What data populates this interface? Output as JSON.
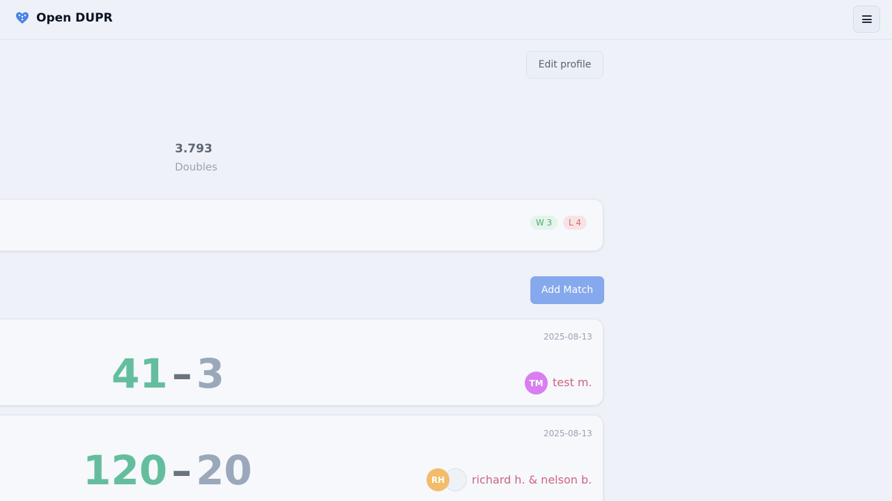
{
  "header": {
    "app_name": "Open DUPR",
    "logo_icon": "pickleball-heart-icon",
    "menu_icon": "hamburger-menu-icon"
  },
  "profile": {
    "edit_label": "Edit profile",
    "rating": {
      "value": "3.793",
      "label": "Doubles"
    }
  },
  "record": {
    "wins": "W 3",
    "losses": "L 4"
  },
  "matches_section": {
    "add_label": "Add Match"
  },
  "matches": [
    {
      "date": "2025-08-13",
      "score_for": "41",
      "dash": "–",
      "score_against": "3",
      "opponent_initials": "TM",
      "opponent_names": "test m."
    },
    {
      "date": "2025-08-13",
      "score_for": "120",
      "dash": "–",
      "score_against": "20",
      "opponent_initials": "RH",
      "opponent_names": "richard h. & nelson b."
    }
  ],
  "colors": {
    "accent": "#86a8ec",
    "win": "#64be9d",
    "loss": "#9aa8ba",
    "opponent_name": "#cf6381",
    "avatar_tm": "#d97ef0",
    "avatar_rh": "#f2bc6a"
  }
}
